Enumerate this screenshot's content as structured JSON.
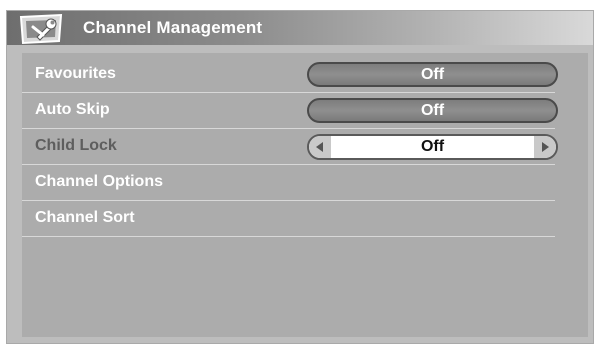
{
  "header": {
    "title": "Channel Management",
    "icon": "wrench-settings-icon"
  },
  "menu": {
    "items": [
      {
        "label": "Favourites",
        "value": "Off",
        "control": "pill",
        "state": "normal"
      },
      {
        "label": "Auto Skip",
        "value": "Off",
        "control": "pill",
        "state": "normal"
      },
      {
        "label": "Child Lock",
        "value": "Off",
        "control": "selector",
        "state": "highlighted"
      },
      {
        "label": "Channel Options",
        "control": "none",
        "state": "normal"
      },
      {
        "label": "Channel Sort",
        "control": "none",
        "state": "normal"
      }
    ]
  },
  "colors": {
    "background": "#bdbdbd",
    "panel": "#acacac",
    "title_gradient_start": "#6e6e6e",
    "label_text": "#ffffff",
    "highlighted_label_text": "#5e5e5e"
  }
}
